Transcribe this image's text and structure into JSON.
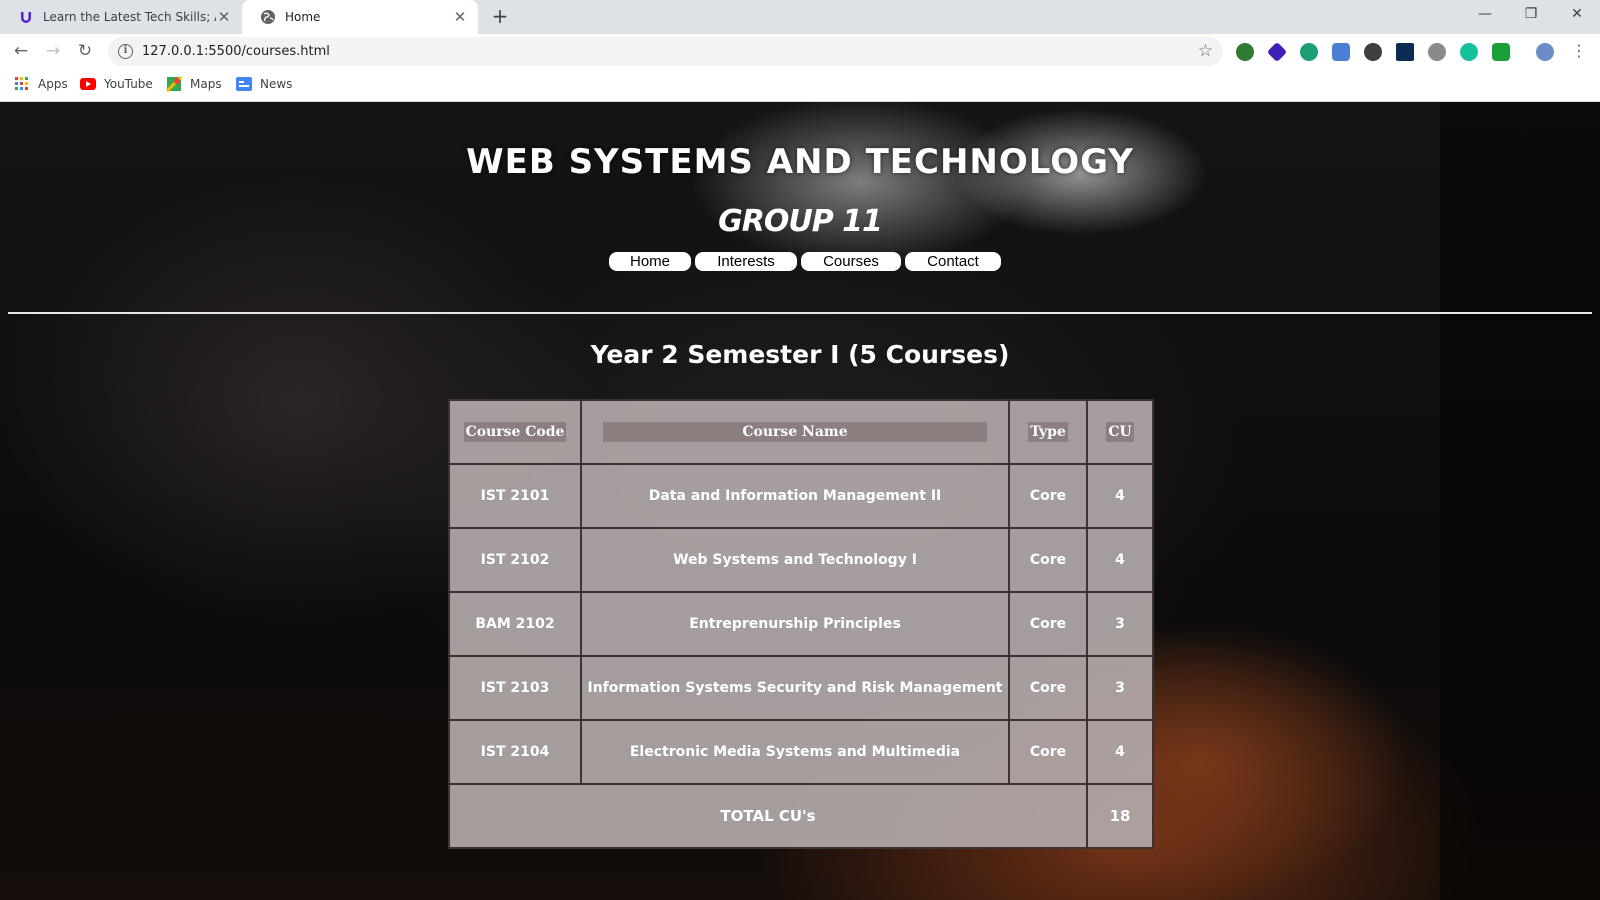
{
  "browser": {
    "tabs": [
      {
        "title": "Learn the Latest Tech Skills; Adva",
        "active": false,
        "icon": "udemy-logo-icon"
      },
      {
        "title": "Home",
        "active": true,
        "icon": "globe-icon"
      }
    ],
    "url": "127.0.0.1:5500/courses.html",
    "bookmarks": [
      {
        "label": "Apps",
        "icon": "apps-grid-icon"
      },
      {
        "label": "YouTube",
        "icon": "youtube-icon"
      },
      {
        "label": "Maps",
        "icon": "maps-icon"
      },
      {
        "label": "News",
        "icon": "news-icon"
      }
    ]
  },
  "site": {
    "title": "WEB SYSTEMS AND TECHNOLOGY",
    "subtitle": "GROUP 11",
    "nav": [
      "Home",
      "Interests",
      "Courses",
      "Contact"
    ]
  },
  "semester": {
    "title": "Year 2 Semester I (5 Courses)",
    "headers": [
      "Course Code",
      "Course Name",
      "Type",
      "CU"
    ],
    "rows": [
      [
        "IST 2101",
        "Data and Information Management II",
        "Core",
        "4"
      ],
      [
        "IST 2102",
        "Web Systems and Technology I",
        "Core",
        "4"
      ],
      [
        "BAM 2102",
        "Entreprenurship Principles",
        "Core",
        "3"
      ],
      [
        "IST 2103",
        "Information Systems Security and Risk Management",
        "Core",
        "3"
      ],
      [
        "IST 2104",
        "Electronic Media Systems and Multimedia",
        "Core",
        "4"
      ]
    ],
    "total_label": "TOTAL CU's",
    "total_value": "18"
  },
  "colors": {
    "table_cell": "#b0a8a8",
    "header_chip": "#8b7f7f",
    "border": "#3b3333"
  }
}
